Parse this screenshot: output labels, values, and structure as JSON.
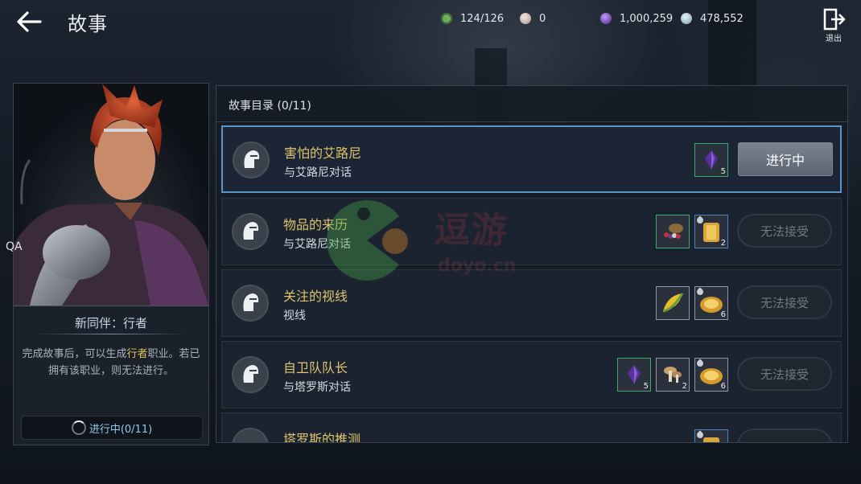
{
  "header": {
    "title": "故事",
    "currencies": [
      {
        "icon": "energy-icon",
        "value": "124/126",
        "color": "#7fbf6a"
      },
      {
        "icon": "pearl-icon",
        "value": "0",
        "color": "#d9c6c2"
      },
      {
        "icon": "purple-crystal-icon",
        "value": "1,000,259",
        "color": "#8a5ad8"
      },
      {
        "icon": "silver-coin-icon",
        "value": "478,552",
        "color": "#b8d2e4"
      }
    ],
    "exit_label": "退出"
  },
  "companion": {
    "name": "新同伴：行者",
    "desc_pre": "完成故事后，可以生成",
    "desc_hl": "行者",
    "desc_post": "职业。若已拥有该职业，则无法进行。",
    "progress": "进行中(0/11)",
    "side_label": "QA"
  },
  "story_list": {
    "header": "故事目录 (0/11)",
    "quests": [
      {
        "name": "害怕的艾路尼",
        "sub": "与艾路尼对话",
        "button": "进行中",
        "active": true,
        "rewards": [
          {
            "icon": "purple-gem-icon",
            "count": "5",
            "frame": "g"
          }
        ]
      },
      {
        "name": "物品的来历",
        "sub": "与艾路尼对话",
        "button": "无法接受",
        "active": false,
        "rewards": [
          {
            "icon": "berries-icon",
            "count": "",
            "frame": "g"
          },
          {
            "icon": "gold-armor-icon",
            "count": "2",
            "frame": "b"
          }
        ]
      },
      {
        "name": "关注的视线",
        "sub": "视线",
        "button": "无法接受",
        "active": false,
        "rewards": [
          {
            "icon": "corn-icon",
            "count": "",
            "frame": "w"
          },
          {
            "icon": "gold-dish-icon",
            "count": "6",
            "frame": "w"
          }
        ]
      },
      {
        "name": "自卫队队长",
        "sub": "与塔罗斯对话",
        "button": "无法接受",
        "active": false,
        "rewards": [
          {
            "icon": "purple-gem-icon",
            "count": "5",
            "frame": "g"
          },
          {
            "icon": "mushroom-icon",
            "count": "2",
            "frame": "w"
          },
          {
            "icon": "gold-dish-icon",
            "count": "6",
            "frame": "w"
          }
        ]
      },
      {
        "name": "塔罗斯的推测",
        "sub": "",
        "button": "",
        "active": false,
        "rewards": [
          {
            "icon": "gold-armor-icon",
            "count": "",
            "frame": "b"
          }
        ]
      }
    ]
  },
  "watermark": {
    "text": "逗游",
    "sub": "doyo.cn"
  }
}
